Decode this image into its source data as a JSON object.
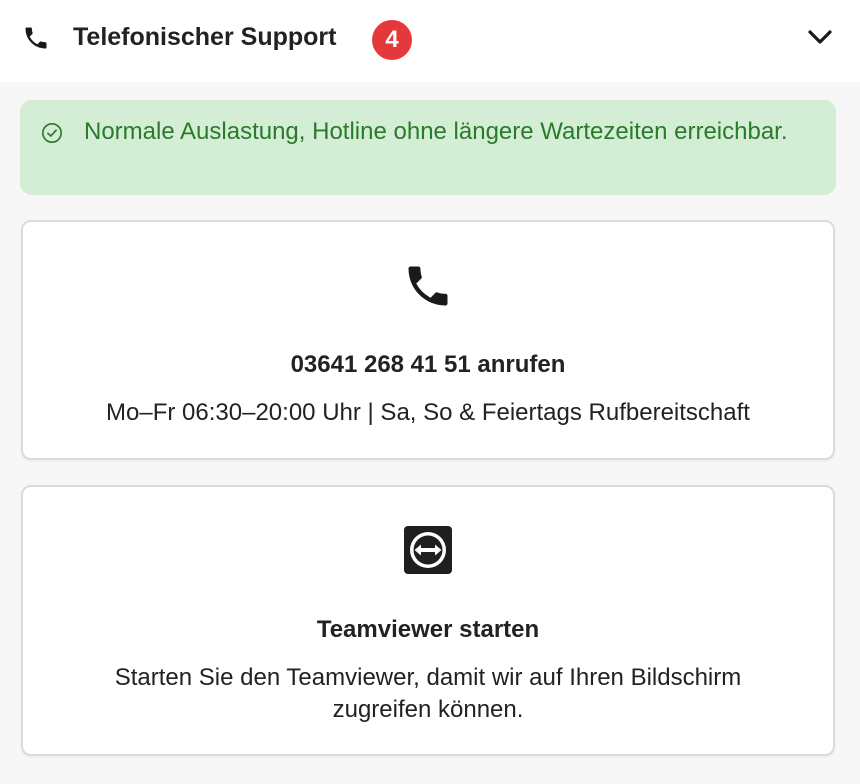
{
  "header": {
    "title": "Telefonischer Support",
    "badge_count": "4",
    "icon": "phone-icon",
    "toggle_icon": "chevron-down-icon"
  },
  "status": {
    "icon": "check-circle-icon",
    "text": "Normale Auslastung, Hotline ohne längere Wartezeiten erreichbar.",
    "color": "#2a7a2c",
    "background": "#d4edd5"
  },
  "cards": [
    {
      "icon": "phone-icon",
      "title": "03641 268 41 51 anrufen",
      "description": "Mo–Fr 06:30–20:00 Uhr | Sa, So & Feiertags Rufbereitschaft"
    },
    {
      "icon": "teamviewer-icon",
      "title": "Teamviewer starten",
      "description": "Starten Sie den Teamviewer, damit wir auf Ihren Bildschirm zugreifen können."
    }
  ],
  "colors": {
    "badge": "#e5383b",
    "text": "#222222",
    "card_border": "#dcdcdc"
  }
}
